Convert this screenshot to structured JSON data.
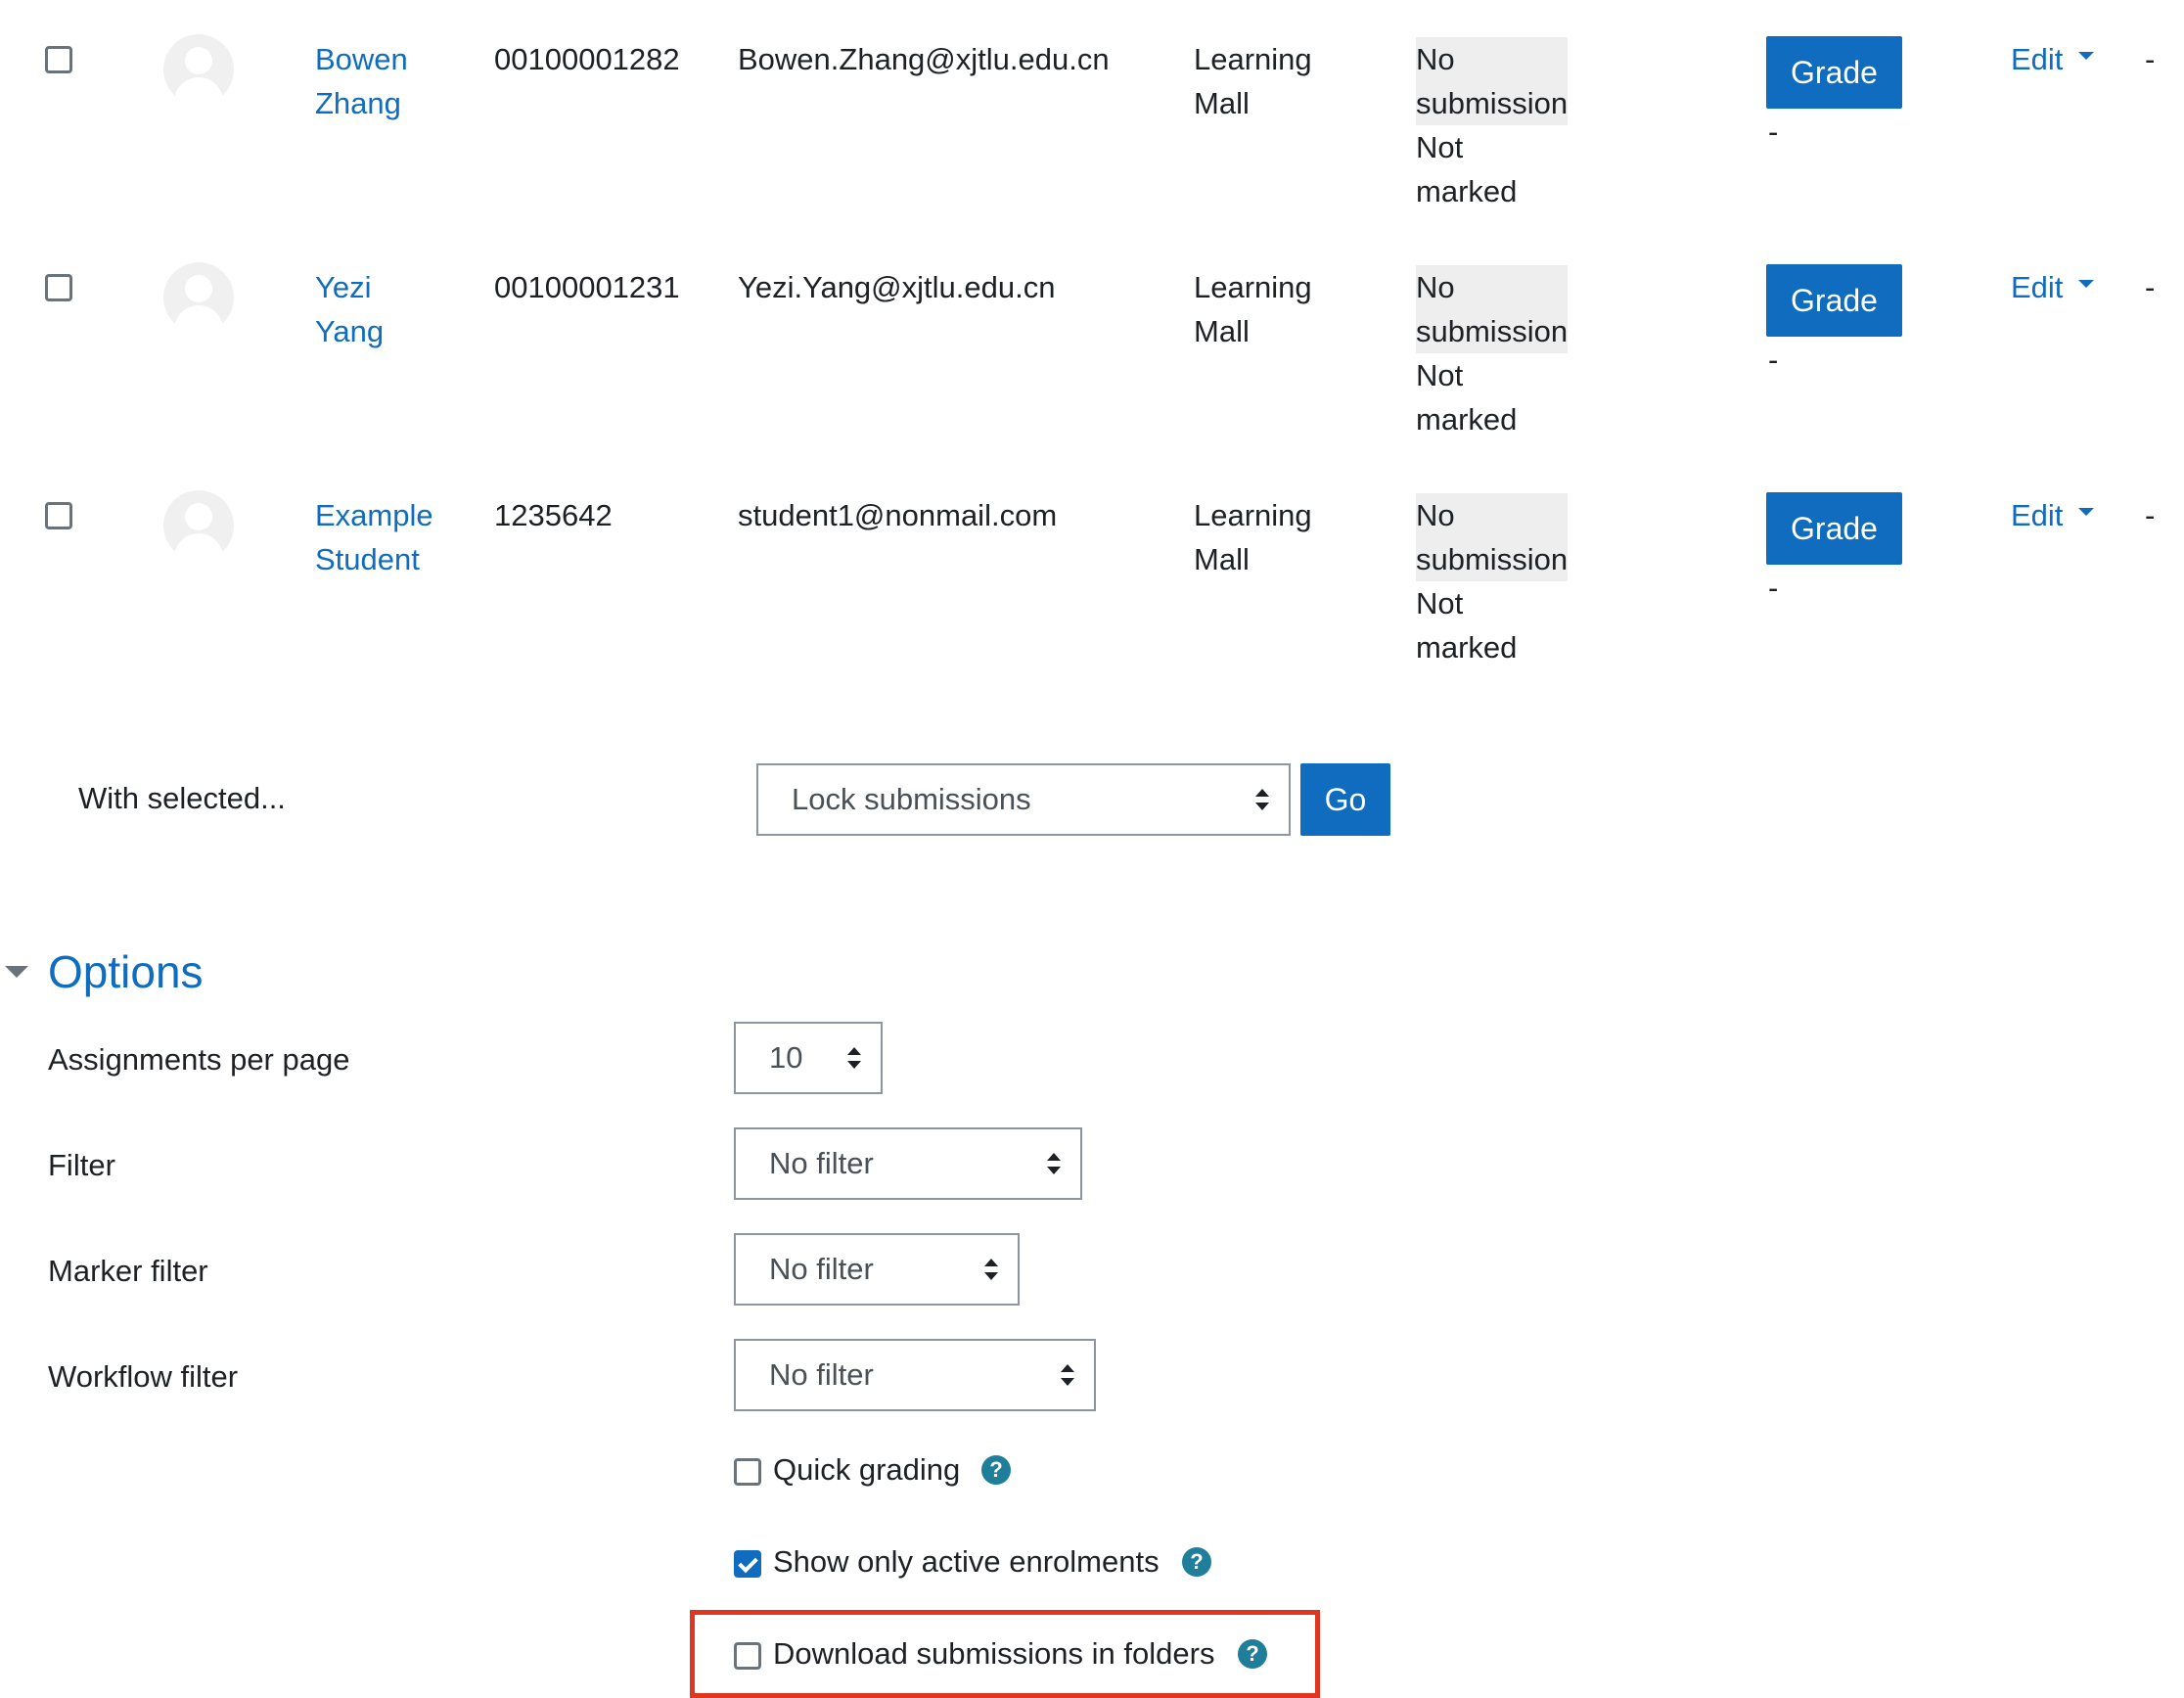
{
  "rows": [
    {
      "first": "Bowen",
      "last": "Zhang",
      "id": "00100001282",
      "email": "Bowen.Zhang@xjtlu.edu.cn",
      "group1": "Learning",
      "group2": "Mall",
      "status1": "No",
      "status2": "submission",
      "status3": "Not",
      "status4": "marked",
      "grade": "Grade",
      "grade_sub": "-",
      "edit": "Edit",
      "last_col": "-"
    },
    {
      "first": "Yezi",
      "last": "Yang",
      "id": "00100001231",
      "email": "Yezi.Yang@xjtlu.edu.cn",
      "group1": "Learning",
      "group2": "Mall",
      "status1": "No",
      "status2": "submission",
      "status3": "Not",
      "status4": "marked",
      "grade": "Grade",
      "grade_sub": "-",
      "edit": "Edit",
      "last_col": "-"
    },
    {
      "first": "Example",
      "last": "Student",
      "id": "1235642",
      "email": "student1@nonmail.com",
      "group1": "Learning",
      "group2": "Mall",
      "status1": "No",
      "status2": "submission",
      "status3": "Not",
      "status4": "marked",
      "grade": "Grade",
      "grade_sub": "-",
      "edit": "Edit",
      "last_col": "-"
    }
  ],
  "bulk": {
    "label": "With selected...",
    "selected_action": "Lock submissions",
    "go_label": "Go"
  },
  "options": {
    "title": "Options",
    "per_page_label": "Assignments per page",
    "per_page_value": "10",
    "filter_label": "Filter",
    "filter_value": "No filter",
    "marker_filter_label": "Marker filter",
    "marker_filter_value": "No filter",
    "workflow_filter_label": "Workflow filter",
    "workflow_filter_value": "No filter",
    "quick_grading_label": "Quick grading",
    "quick_grading_checked": false,
    "active_enrolments_label": "Show only active enrolments",
    "active_enrolments_checked": true,
    "download_folders_label": "Download submissions in folders",
    "download_folders_checked": false,
    "help_glyph": "?"
  },
  "colors": {
    "accent": "#0f6cbf",
    "help_icon": "#1f7e9a",
    "highlight_box": "#e0351f",
    "status_bg": "#eeeeee"
  }
}
